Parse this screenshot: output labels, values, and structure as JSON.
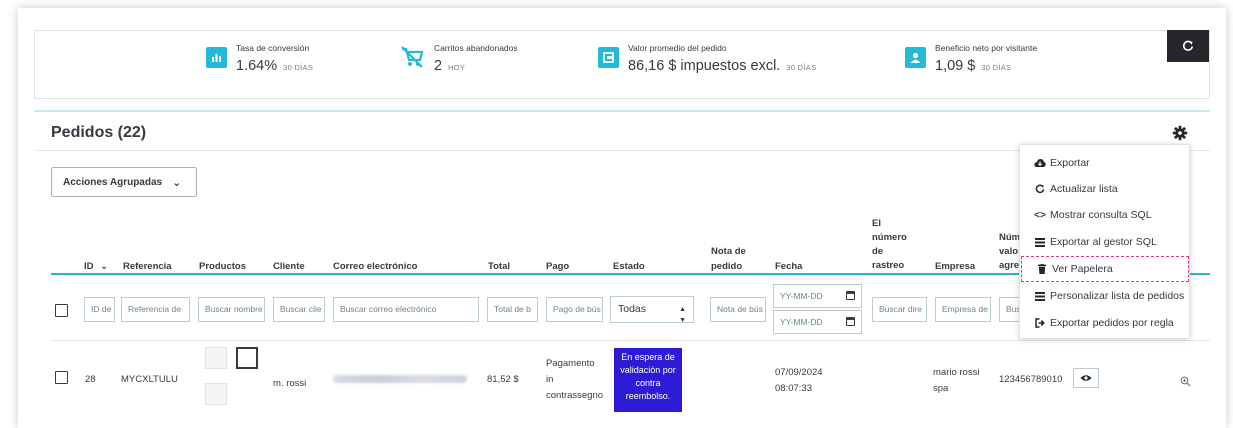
{
  "kpis": [
    {
      "title": "Tasa de conversión",
      "value": "1.64%",
      "sub": "30 DÍAS",
      "icon": "bar-chart-icon"
    },
    {
      "title": "Carritos abandonados",
      "value": "2",
      "sub": "HOY",
      "icon": "cart-off-icon"
    },
    {
      "title": "Valor promedio del pedido",
      "value": "86,16 $ impuestos excl.",
      "sub": "30 DÍAS",
      "icon": "card-icon"
    },
    {
      "title": "Beneficio neto por visitante",
      "value": "1,09 $",
      "sub": "30 DÍAS",
      "icon": "person-icon"
    }
  ],
  "refresh_icon": "refresh-icon",
  "panel": {
    "title": "Pedidos (22)",
    "bulk_actions": "Acciones Agrupadas"
  },
  "table": {
    "headers": {
      "id": "ID",
      "reference": "Referencia",
      "products": "Productos",
      "customer": "Cliente",
      "email": "Correo electrónico",
      "total": "Total",
      "payment": "Pago",
      "status": "Estado",
      "note_1": "Nota de",
      "note_2": "pedido",
      "date": "Fecha",
      "tracking_1": "El",
      "tracking_2": "número",
      "tracking_3": "de",
      "tracking_4": "rastreo",
      "company": "Empresa",
      "vat_1": "Núm",
      "vat_2": "valo",
      "vat_3": "agre"
    },
    "filters": {
      "id": "ID de",
      "reference": "Referencia de",
      "products": "Buscar nombre",
      "customer": "Buscar clie",
      "email": "Buscar correo electrónico",
      "total": "Total de b",
      "payment": "Pago de bús",
      "status": "Todas",
      "note": "Nota de bús",
      "date_from": "YY-MM-DD",
      "date_to": "YY-MM-DD",
      "tracking": "Buscar dire",
      "company": "Empresa de",
      "vat": "Bus"
    },
    "rows": [
      {
        "id": "28",
        "reference": "MYCXLTULU",
        "customer": "m. rossi",
        "total": "81,52 $",
        "payment_1": "Pagamento",
        "payment_2": "in",
        "payment_3": "contrassegno",
        "status_1": "En espera de",
        "status_2": "validación por",
        "status_3": "contra",
        "status_4": "reembolso.",
        "date_1": "07/09/2024",
        "date_2": "08:07:33",
        "company_1": "mario rossi",
        "company_2": "spa",
        "vat": "123456789010"
      }
    ]
  },
  "dropdown": {
    "items": [
      {
        "label": "Exportar",
        "icon": "cloud-download-icon"
      },
      {
        "label": "Actualizar lista",
        "icon": "refresh-icon"
      },
      {
        "label": "Mostrar consulta SQL",
        "icon": "code-icon"
      },
      {
        "label": "Exportar al gestor SQL",
        "icon": "list-icon"
      },
      {
        "label": "Ver Papelera",
        "icon": "trash-icon"
      },
      {
        "label": "Personalizar lista de pedidos",
        "icon": "list-icon"
      },
      {
        "label": "Exportar pedidos por regla",
        "icon": "export-icon"
      }
    ]
  },
  "colors": {
    "accent": "#25b9d7",
    "status_badge": "#2e1bd6",
    "highlight_border": "#e9358a",
    "dark_button": "#25272b"
  }
}
